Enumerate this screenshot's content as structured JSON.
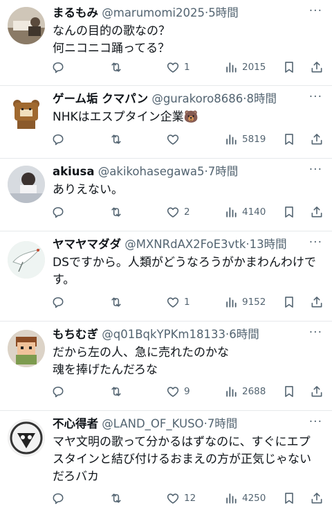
{
  "tweets": [
    {
      "name": "まるもみ",
      "handle": "@marumomi2025",
      "sep": "·",
      "time": "5時間",
      "lines": [
        "なんの目的の歌なの？",
        "何ニコニコ踊ってる？"
      ],
      "replies": "",
      "retweets": "",
      "likes": "1",
      "views": "2015"
    },
    {
      "name": "ゲーム垢 クマパン",
      "handle": "@gurakoro8686",
      "sep": "·",
      "time": "8時間",
      "lines": [
        "NHKはエスプタイン企業🐻"
      ],
      "replies": "",
      "retweets": "",
      "likes": "",
      "views": "5819"
    },
    {
      "name": "akiusa",
      "handle": "@akikohasegawa5",
      "sep": "·",
      "time": "7時間",
      "lines": [
        "ありえない。"
      ],
      "replies": "",
      "retweets": "",
      "likes": "2",
      "views": "4140"
    },
    {
      "name": "ヤマヤマダダ",
      "handle": "@MXNRdAX2FoE3vtk",
      "sep": "·",
      "time": "13時間",
      "lines": [
        "DSですから。人類がどうなろうがかまわんわけで",
        "す。"
      ],
      "replies": "",
      "retweets": "",
      "likes": "1",
      "views": "9152"
    },
    {
      "name": "もちむぎ",
      "handle": "@q01BqkYPKm18133",
      "sep": "·",
      "time": "6時間",
      "lines": [
        "だから左の人、急に売れたのかな",
        "魂を捧げたんだろな"
      ],
      "replies": "",
      "retweets": "",
      "likes": "9",
      "views": "2688"
    },
    {
      "name": "不心得者",
      "handle": "@LAND_OF_KUSO",
      "sep": "·",
      "time": "7時間",
      "lines": [
        "マヤ文明の歌って分かるはずなのに、すぐにエプ",
        "スタインと結び付けるおまえの方が正気じゃない",
        "だろバカ"
      ],
      "replies": "",
      "retweets": "",
      "likes": "12",
      "views": "4250"
    }
  ],
  "icons": {
    "more": "more-horizontal-icon",
    "reply": "reply-icon",
    "retweet": "retweet-icon",
    "like": "heart-icon",
    "views": "views-chart-icon",
    "bookmark": "bookmark-icon",
    "share": "share-icon"
  },
  "colors": {
    "text": "#0f1419",
    "secondary": "#536471",
    "divider": "#e6e9eb"
  }
}
